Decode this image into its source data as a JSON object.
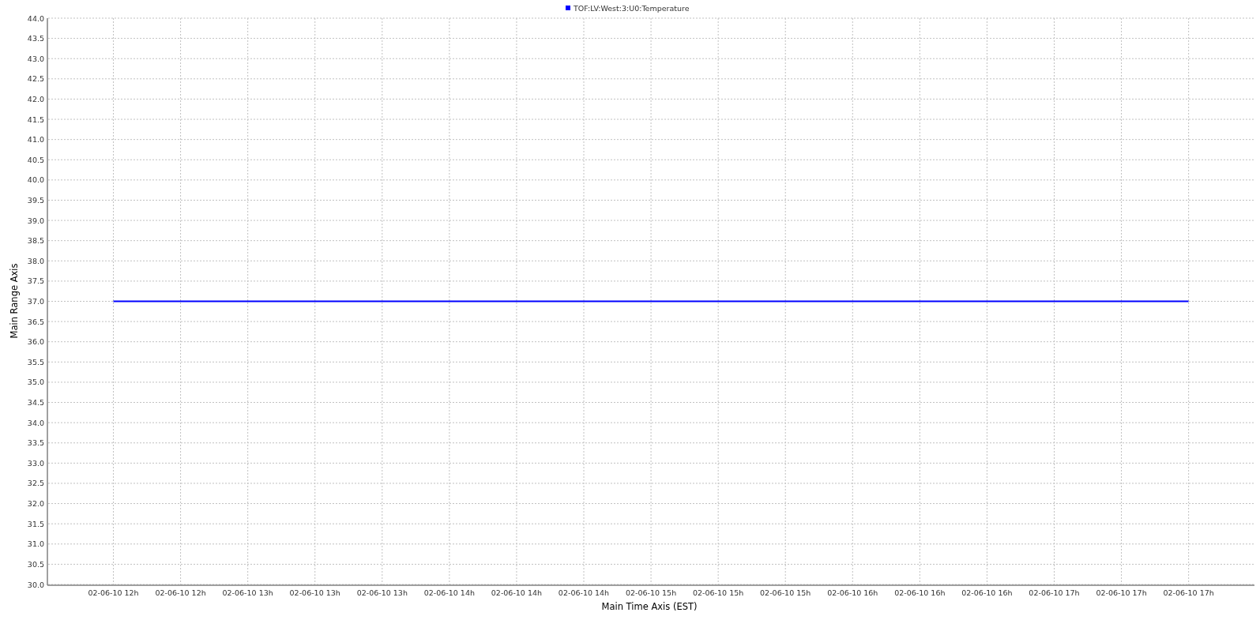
{
  "chart_data": {
    "type": "line",
    "grid": true,
    "xlabel": "Main Time Axis (EST)",
    "ylabel": "Main Range Axis",
    "ylim": [
      30,
      44
    ],
    "categories": [
      "02-06-10 12h",
      "02-06-10 12h",
      "02-06-10 13h",
      "02-06-10 13h",
      "02-06-10 13h",
      "02-06-10 14h",
      "02-06-10 14h",
      "02-06-10 14h",
      "02-06-10 15h",
      "02-06-10 15h",
      "02-06-10 15h",
      "02-06-10 16h",
      "02-06-10 16h",
      "02-06-10 16h",
      "02-06-10 17h",
      "02-06-10 17h",
      "02-06-10 17h"
    ],
    "yticks": [
      {
        "value": 30,
        "label": "30.0"
      },
      {
        "value": 30.5,
        "label": "30.5"
      },
      {
        "value": 31,
        "label": "31.0"
      },
      {
        "value": 31.5,
        "label": "31.5"
      },
      {
        "value": 32,
        "label": "32.0"
      },
      {
        "value": 32.5,
        "label": "32.5"
      },
      {
        "value": 33,
        "label": "33.0"
      },
      {
        "value": 33.5,
        "label": "33.5"
      },
      {
        "value": 34,
        "label": "34.0"
      },
      {
        "value": 34.5,
        "label": "34.5"
      },
      {
        "value": 35,
        "label": "35.0"
      },
      {
        "value": 35.5,
        "label": "35.5"
      },
      {
        "value": 36,
        "label": "36.0"
      },
      {
        "value": 36.5,
        "label": "36.5"
      },
      {
        "value": 37,
        "label": "37.0"
      },
      {
        "value": 37.5,
        "label": "37.5"
      },
      {
        "value": 38,
        "label": "38.0"
      },
      {
        "value": 38.5,
        "label": "38.5"
      },
      {
        "value": 39,
        "label": "39.0"
      },
      {
        "value": 39.5,
        "label": "39.5"
      },
      {
        "value": 40,
        "label": "40.0"
      },
      {
        "value": 40.5,
        "label": "40.5"
      },
      {
        "value": 41,
        "label": "41.0"
      },
      {
        "value": 41.5,
        "label": "41.5"
      },
      {
        "value": 42,
        "label": "42.0"
      },
      {
        "value": 42.5,
        "label": "42.5"
      },
      {
        "value": 43,
        "label": "43.0"
      },
      {
        "value": 43.5,
        "label": "43.5"
      },
      {
        "value": 44,
        "label": "44.0"
      }
    ],
    "series": [
      {
        "name": "TOF:LV:West:3:U0:Temperature",
        "color": "#0000ff",
        "values": [
          37.0,
          37.0,
          37.0,
          37.0,
          37.0,
          37.0,
          37.0,
          37.0,
          37.0,
          37.0,
          37.0,
          37.0,
          37.0,
          37.0,
          37.0,
          37.0,
          37.0
        ]
      }
    ]
  }
}
